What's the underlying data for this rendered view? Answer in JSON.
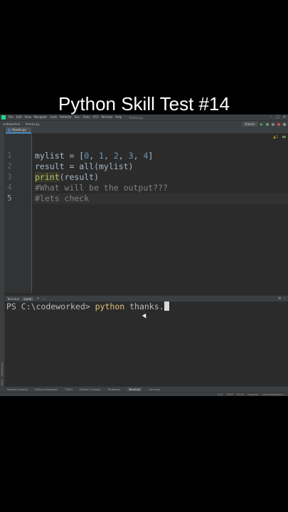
{
  "headline": "Python Skill Test #14",
  "menu": {
    "items": [
      "File",
      "Edit",
      "View",
      "Navigate",
      "Code",
      "Refactor",
      "Run",
      "Tools",
      "VCS",
      "Window",
      "Help"
    ],
    "project_path": "thanks.py"
  },
  "nav": {
    "breadcrumbs": [
      "codeworked",
      "thanks.py"
    ],
    "run_config": "thanks"
  },
  "editor": {
    "tab": "thanks.py",
    "lines": [
      {
        "no": "1",
        "parts": [
          {
            "t": "mylist = [",
            "c": ""
          },
          {
            "t": "0",
            "c": "num"
          },
          {
            "t": ", ",
            "c": ""
          },
          {
            "t": "1",
            "c": "num"
          },
          {
            "t": ", ",
            "c": ""
          },
          {
            "t": "2",
            "c": "num"
          },
          {
            "t": ", ",
            "c": ""
          },
          {
            "t": "3",
            "c": "num"
          },
          {
            "t": ", ",
            "c": ""
          },
          {
            "t": "4",
            "c": "num"
          },
          {
            "t": "]",
            "c": ""
          }
        ]
      },
      {
        "no": "2",
        "parts": [
          {
            "t": "result = all(mylist)",
            "c": ""
          }
        ]
      },
      {
        "no": "3",
        "parts": [
          {
            "t": "print",
            "c": "builtin"
          },
          {
            "t": "(result)",
            "c": ""
          }
        ]
      },
      {
        "no": "4",
        "parts": [
          {
            "t": "#What will be the output???",
            "c": "comment"
          }
        ]
      },
      {
        "no": "5",
        "parts": [
          {
            "t": "#lets check",
            "c": "comment"
          }
        ]
      }
    ],
    "active_line": 5,
    "warning": "▲1"
  },
  "terminal": {
    "tab_title": "Terminal",
    "session_tab": "Local",
    "prompt": "PS C:\\codeworked> ",
    "command": "python",
    "argument": " thanks."
  },
  "bottom_tools": [
    "Version Control",
    "Python Packages",
    "TODO",
    "Python Console",
    "Problems",
    "Terminal",
    "Services"
  ],
  "bottom_active": "Terminal",
  "status": [
    "4:12",
    "CRLF",
    "UTF-8",
    "4 spaces",
    "<No interpreter>"
  ],
  "side_tools": [
    "Structure",
    "Bookmarks"
  ]
}
